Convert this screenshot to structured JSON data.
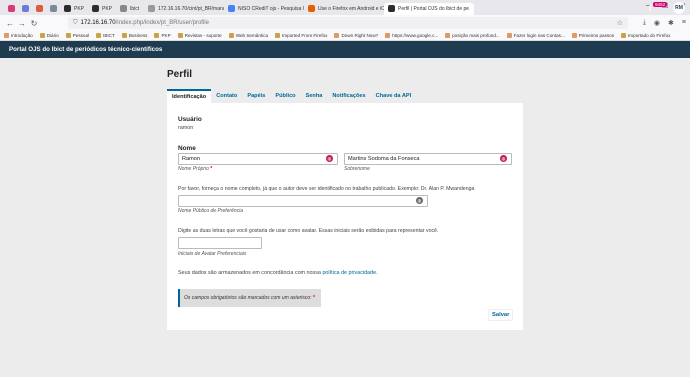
{
  "browser": {
    "tabs": [
      {
        "label": "",
        "color": "#d83a7a"
      },
      {
        "label": "",
        "color": "#6b7bd6"
      },
      {
        "label": "",
        "color": "#e05b3a"
      },
      {
        "label": "",
        "color": "#7a8a99"
      },
      {
        "label": "PKP",
        "color": "#2c2c2c"
      },
      {
        "label": "PKP",
        "color": "#2c2c2c"
      },
      {
        "label": "Ibict",
        "color": "#888888"
      },
      {
        "label": "172.16.16.70/cint/pt_BR/manu",
        "color": "#999999"
      },
      {
        "label": "NISO CRediT ojs - Pesquisa Go",
        "color": "#4285f4"
      },
      {
        "label": "Use o Firefox em Android e iOS",
        "color": "#e66000"
      },
      {
        "label": "Perfil | Portal OJS do Ibict de pe",
        "color": "#2c2c2c",
        "active": true
      }
    ],
    "url_host": "172.16.16.70",
    "url_path": "/index.php/index/pt_BR/user/profile",
    "bookmarks": [
      {
        "label": "Introdução",
        "folder": false
      },
      {
        "label": "Diário",
        "folder": true
      },
      {
        "label": "Pessoal",
        "folder": true
      },
      {
        "label": "IBICT",
        "folder": true
      },
      {
        "label": "Business",
        "folder": true
      },
      {
        "label": "PKP",
        "folder": true
      },
      {
        "label": "Revistas - suporte",
        "folder": true
      },
      {
        "label": "Web Semântica",
        "folder": true
      },
      {
        "label": "Imported From Firefox",
        "folder": true
      },
      {
        "label": "Down Right Now?",
        "folder": false
      },
      {
        "label": "https://www.google.c...",
        "folder": false
      },
      {
        "label": "posição mais profund...",
        "folder": false
      },
      {
        "label": "Fazer login nas Contas...",
        "folder": false
      },
      {
        "label": "Primeiros passos",
        "folder": false
      },
      {
        "label": "Importado do Firefox",
        "folder": true
      }
    ]
  },
  "header": {
    "title": "Portal OJS do Ibict de periódicos técnico-científicos",
    "notification_count": "9452",
    "avatar_initials": "RM"
  },
  "page": {
    "title": "Perfil",
    "tabs": [
      "Identificação",
      "Contato",
      "Papéis",
      "Público",
      "Senha",
      "Notificações",
      "Chave da API"
    ],
    "active_tab": "Identificação"
  },
  "form": {
    "username_label": "Usuário",
    "username_value": "ramon",
    "name_label": "Nome",
    "given_name_value": "Ramon",
    "given_name_hint": "Nome Próprio",
    "family_name_value": "Martins Sodoma da Fonseca",
    "family_name_hint": "Sobrenome",
    "required_mark": "*",
    "public_name_desc": "Por favor, forneça o nome completo, já que o autor deve ser identificado no trabalho publicado. Exemplo: Dr. Alan P. Mwandenga",
    "public_name_value": "",
    "public_name_hint": "Nome Público de Preferência",
    "initials_desc": "Digite as duas letras que você gostaria de usar como avatar. Essas iniciais serão exibidas para representar você.",
    "initials_value": "",
    "initials_hint": "Iniciais de Avatar Preferenciais",
    "privacy_text": "Seus dados são armazenados em concordância com nossa",
    "privacy_link": "política de privacidade",
    "privacy_end": ".",
    "required_notice": "Os campos obrigatórios são marcados com um asterisco:",
    "save_label": "Salvar"
  },
  "colors": {
    "header_bg": "#1f3b4f",
    "link": "#006798",
    "globe_pink": "#c2185b",
    "globe_grey": "#666666"
  }
}
